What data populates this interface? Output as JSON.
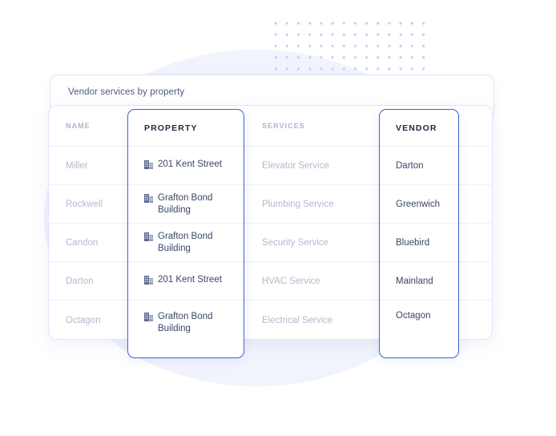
{
  "header": {
    "title": "Vendor services by property"
  },
  "table": {
    "columns": [
      {
        "key": "name",
        "label": "NAME",
        "highlighted": false
      },
      {
        "key": "property",
        "label": "PROPERTY",
        "highlighted": true
      },
      {
        "key": "services",
        "label": "SERVICES",
        "highlighted": false
      },
      {
        "key": "vendor",
        "label": "VENDOR",
        "highlighted": true
      }
    ],
    "property_icon": "building-icon",
    "rows": [
      {
        "name": "Miller",
        "property": "201 Kent Street",
        "services": "Elevator Service",
        "vendor": "Darton"
      },
      {
        "name": "Rockwell",
        "property": "Grafton Bond\nBuilding",
        "services": "Plumbing Service",
        "vendor": "Greenwich"
      },
      {
        "name": "Candon",
        "property": "Grafton Bond\nBuilding",
        "services": "Security Service",
        "vendor": "Bluebird"
      },
      {
        "name": "Darton",
        "property": "201 Kent Street",
        "services": "HVAC Service",
        "vendor": "Mainland"
      },
      {
        "name": "Octagon",
        "property": "Grafton Bond\nBuilding",
        "services": "Electrical Service",
        "vendor": "Octagon"
      }
    ]
  },
  "colors": {
    "accent": "#3f63d4",
    "card_border": "#dde5f9",
    "muted_text": "#b2bacd",
    "strong_text": "#3b4668",
    "background_shape": "#eef2fb",
    "dot_grid": "#c7d2f5"
  }
}
